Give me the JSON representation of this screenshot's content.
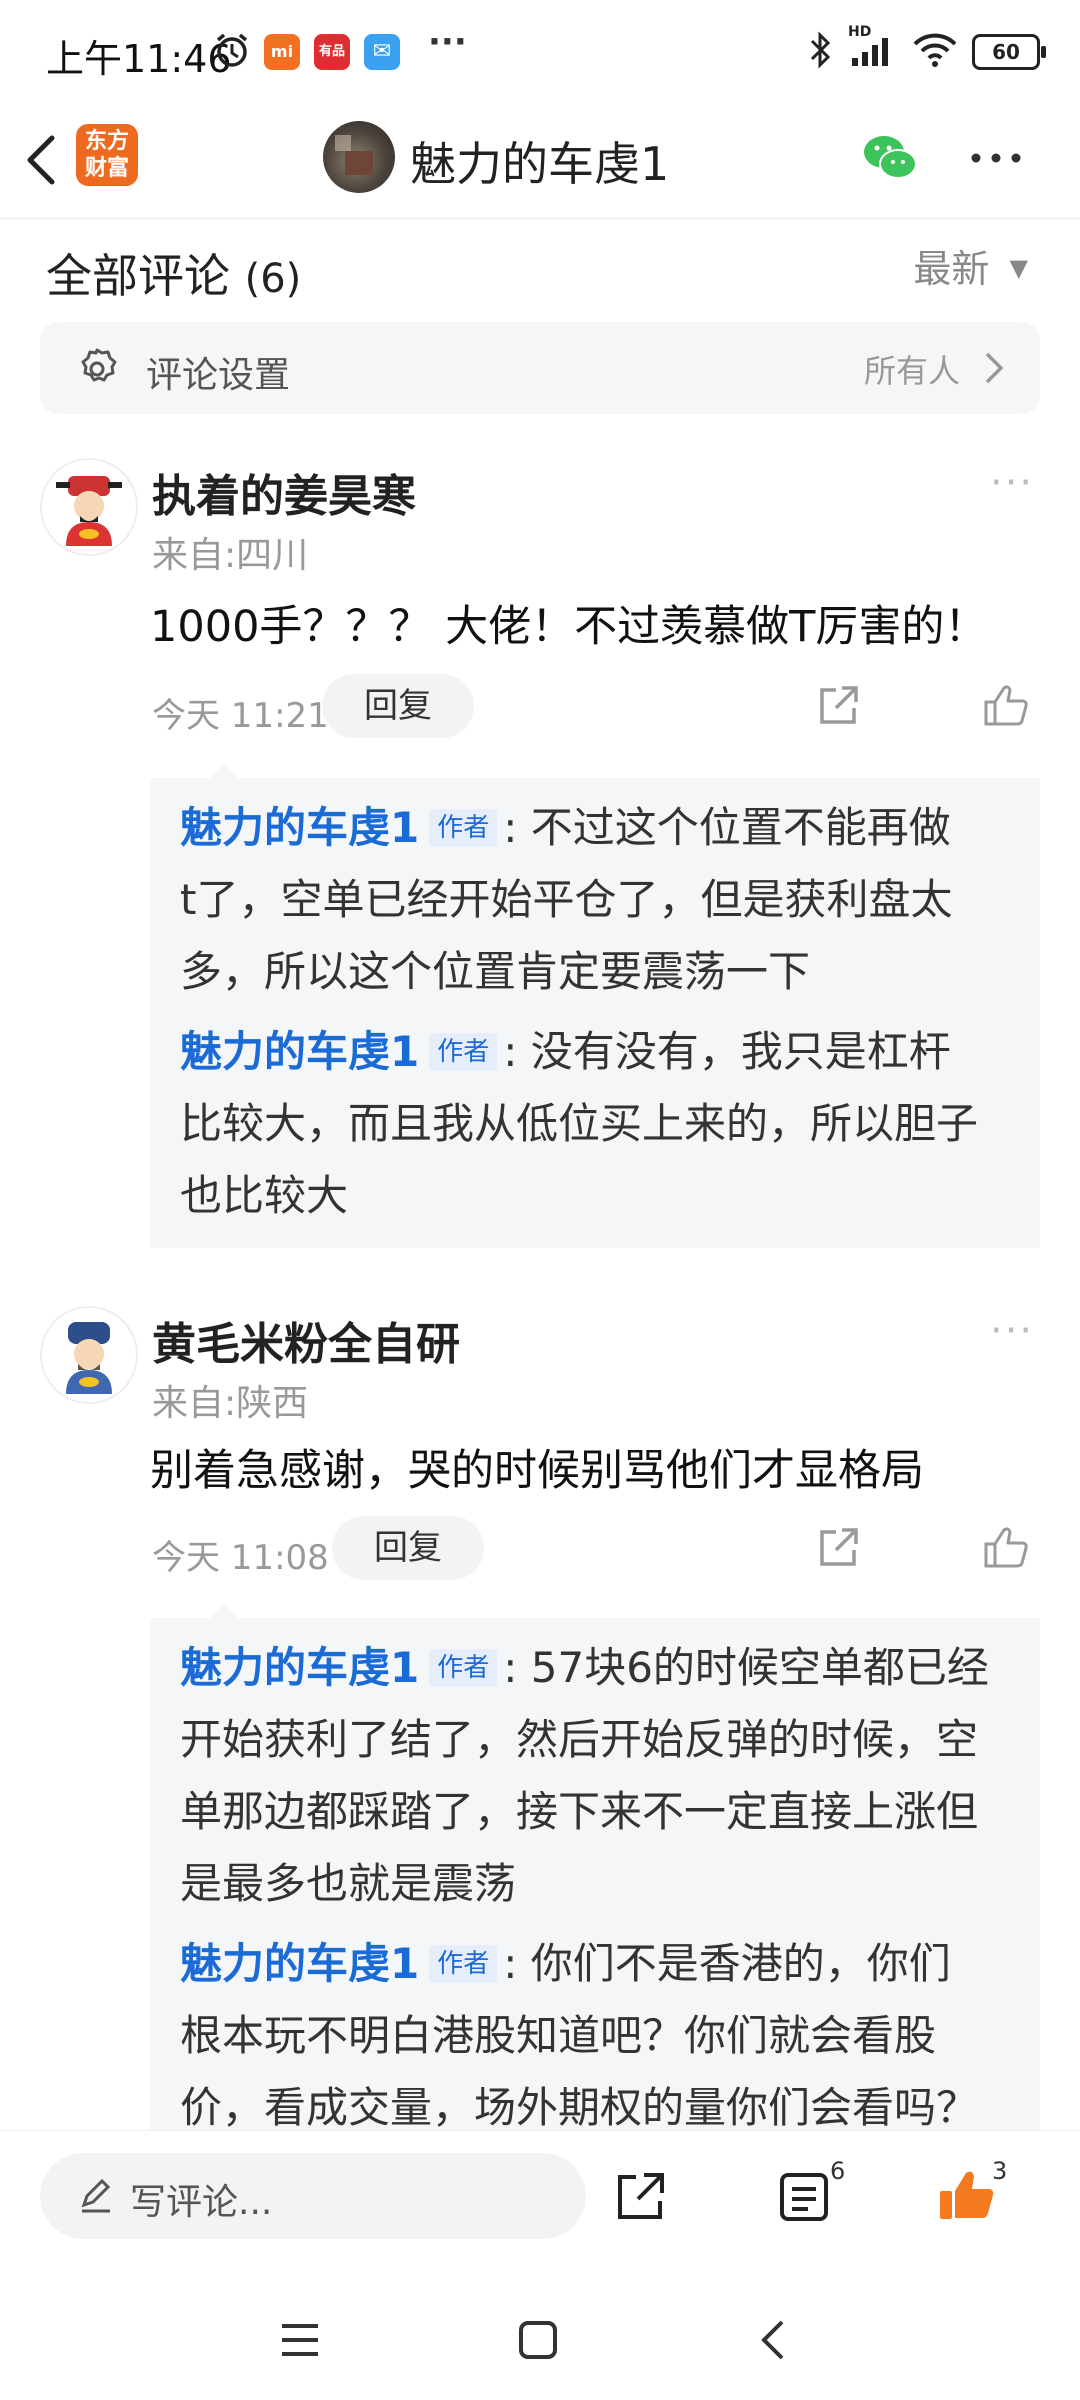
{
  "status_bar": {
    "time": "上午11:46",
    "battery": "60",
    "network": "HD",
    "more": "···",
    "app_icons": [
      {
        "name": "mi-icon",
        "label": "mi",
        "color": "#f36f21"
      },
      {
        "name": "youpin-icon",
        "label": "有品",
        "color": "#e02d33"
      },
      {
        "name": "mail-icon",
        "label": "✉",
        "color": "#3aa0f0"
      }
    ]
  },
  "header": {
    "back_icon": "back-icon",
    "logo_text": "东方\n财富",
    "title": "魅力的车虔1",
    "wechat_icon": "wechat-icon",
    "more_icon": "more-icon"
  },
  "comments_section": {
    "title": "全部评论",
    "count": "(6)",
    "sort_label": "最新",
    "settings_label": "评论设置",
    "settings_value": "所有人"
  },
  "comments": [
    {
      "username": "执着的姜昊寒",
      "location": "来自:四川",
      "text": "1000手？？？ 大佬！不过羡慕做T厉害的！",
      "time": "今天 11:21",
      "reply_label": "回复",
      "replies": [
        {
          "author": "魅力的车虔1",
          "tag": "作者",
          "lines": [
            ": 不过这个位置不能再做",
            "t了，空单已经开始平仓了，但是获利盘太",
            "多，所以这个位置肯定要震荡一下"
          ]
        },
        {
          "author": "魅力的车虔1",
          "tag": "作者",
          "lines": [
            ": 没有没有，我只是杠杆",
            "比较大，而且我从低位买上来的，所以胆子",
            "也比较大"
          ]
        }
      ]
    },
    {
      "username": "黄毛米粉全自研",
      "location": "来自:陕西",
      "text": "别着急感谢，哭的时候别骂他们才显格局",
      "time": "今天 11:08",
      "reply_label": "回复",
      "replies": [
        {
          "author": "魅力的车虔1",
          "tag": "作者",
          "lines": [
            ": 57块6的时候空单都已经",
            "开始获利了结了，然后开始反弹的时候，空",
            "单那边都踩踏了，接下来不一定直接上涨但",
            "是最多也就是震荡"
          ]
        },
        {
          "author": "魅力的车虔1",
          "tag": "作者",
          "lines": [
            ": 你们不是香港的，你们",
            "根本玩不明白港股知道吧？你们就会看股",
            "价，看成交量，场外期权的量你们会看吗？"
          ]
        }
      ]
    }
  ],
  "bottom_bar": {
    "write_placeholder": "写评论...",
    "comment_count": "6",
    "like_count": "3"
  },
  "colors": {
    "accent_blue": "#1a6bd6",
    "like_orange": "#f47a1f",
    "logo_orange": "#ef6a21",
    "wechat_green": "#3cc35a"
  }
}
